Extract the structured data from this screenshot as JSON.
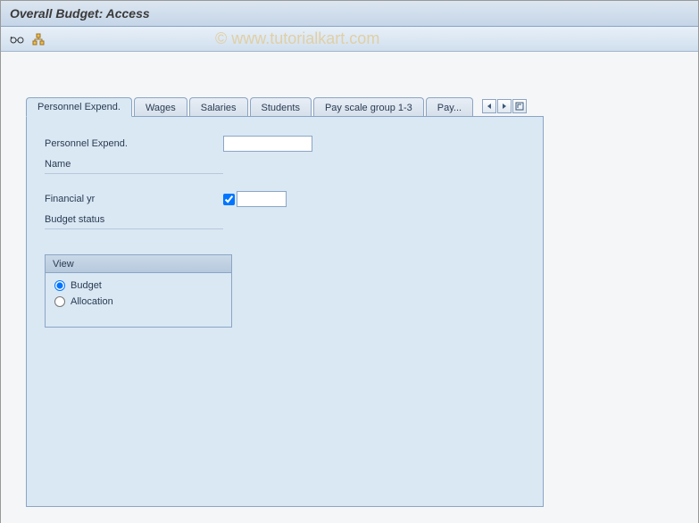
{
  "title": "Overall Budget: Access",
  "watermark": "© www.tutorialkart.com",
  "tabs": {
    "items": [
      {
        "label": "Personnel Expend."
      },
      {
        "label": "Wages"
      },
      {
        "label": "Salaries"
      },
      {
        "label": "Students"
      },
      {
        "label": "Pay scale group 1-3"
      },
      {
        "label": "Pay..."
      }
    ],
    "active_index": 0
  },
  "form": {
    "personnel_expend": {
      "label": "Personnel Expend.",
      "value": ""
    },
    "name": {
      "label": "Name",
      "value": ""
    },
    "financial_yr": {
      "label": "Financial yr",
      "value": "",
      "checked": true
    },
    "budget_status": {
      "label": "Budget status",
      "value": ""
    }
  },
  "view_group": {
    "title": "View",
    "options": [
      {
        "label": "Budget",
        "selected": true
      },
      {
        "label": "Allocation",
        "selected": false
      }
    ]
  }
}
